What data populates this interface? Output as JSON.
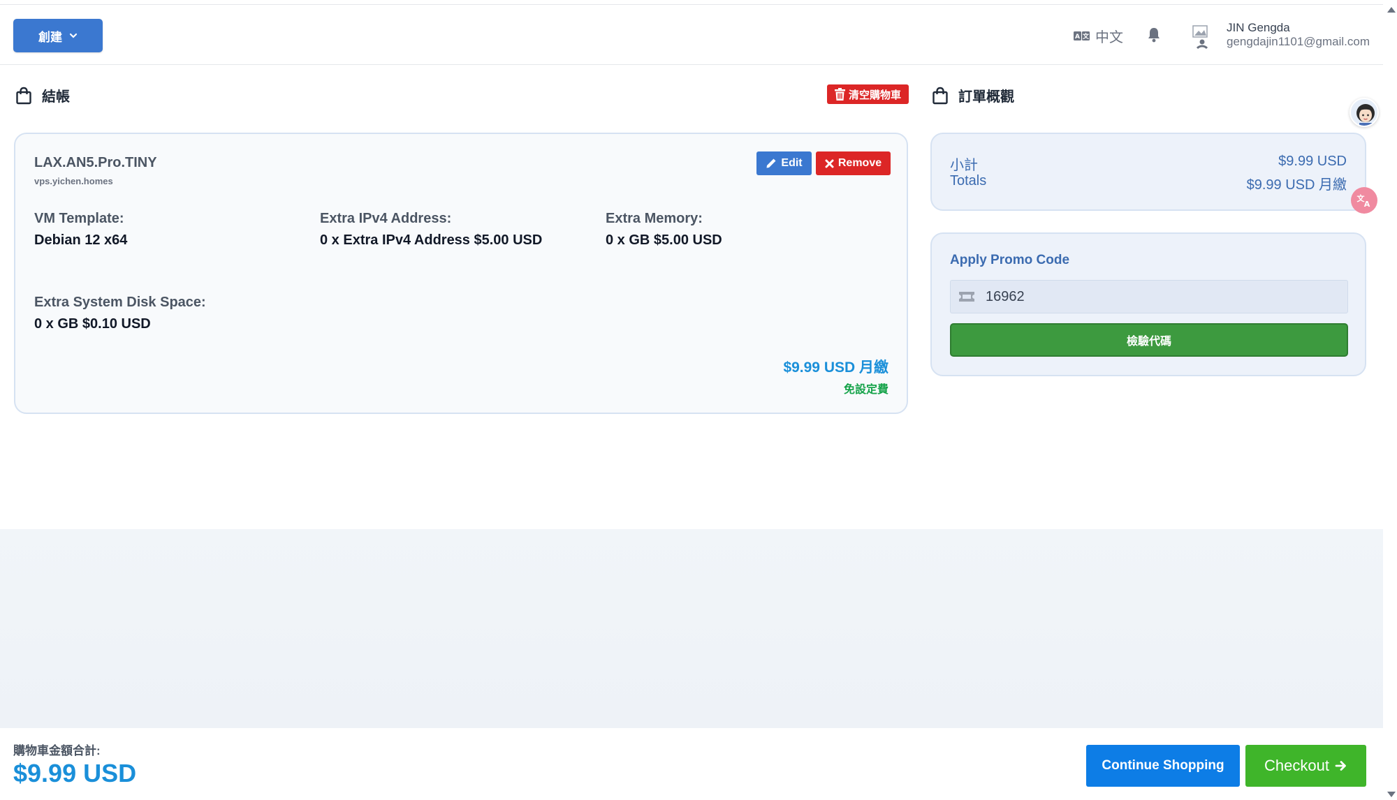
{
  "header": {
    "create_label": "創建",
    "language_label": "中文",
    "user_name": "JIN Gengda",
    "user_email": "gengdajin1101@gmail.com"
  },
  "checkout": {
    "title": "結帳",
    "clear_cart_label": "清空購物車"
  },
  "product": {
    "name": "LAX.AN5.Pro.TINY",
    "hostname": "vps.yichen.homes",
    "edit_label": "Edit",
    "remove_label": "Remove",
    "options": [
      {
        "label": "VM Template:",
        "value": "Debian 12 x64"
      },
      {
        "label": "Extra IPv4 Address:",
        "value": "0 x Extra IPv4 Address $5.00 USD"
      },
      {
        "label": "Extra Memory:",
        "value": "0 x GB $5.00 USD"
      },
      {
        "label": "Extra System Disk Space:",
        "value": "0 x GB $0.10 USD"
      }
    ],
    "price": "$9.99 USD 月繳",
    "setup_fee": "免設定費"
  },
  "summary": {
    "title": "訂單概觀",
    "subtotal_label": "小計",
    "subtotal_value": "$9.99 USD",
    "totals_label": "Totals",
    "totals_value": "$9.99 USD 月繳"
  },
  "promo": {
    "title": "Apply Promo Code",
    "code_value": "16962",
    "validate_label": "檢驗代碼"
  },
  "footer": {
    "total_label": "購物車金額合計:",
    "total_value": "$9.99 USD",
    "continue_label": "Continue Shopping",
    "checkout_label": "Checkout"
  },
  "colors": {
    "primary": "#3b78d0",
    "danger": "#dc2626",
    "success": "#3d9a3f",
    "price_blue": "#1a8fd9",
    "checkout_green": "#3fb52a"
  },
  "icons": [
    "chevron-down-icon",
    "translate-icon",
    "bell-icon",
    "avatar",
    "shopping-bag-icon",
    "trash-icon",
    "pencil-icon",
    "close-icon",
    "ticket-icon",
    "arrow-right-icon"
  ]
}
